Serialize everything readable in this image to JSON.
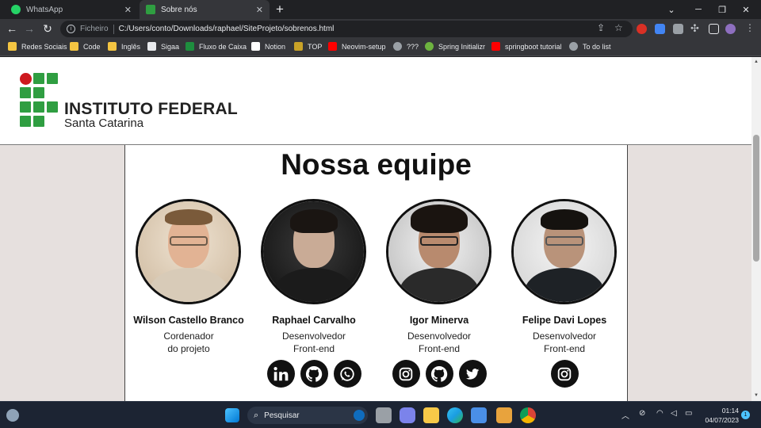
{
  "browser": {
    "tabs": [
      {
        "title": "WhatsApp",
        "close": "✕"
      },
      {
        "title": "Sobre nós",
        "close": "✕"
      }
    ],
    "new_tab": "+",
    "window_controls": {
      "minimize": "─",
      "maximize": "❐",
      "close": "✕",
      "tabsearch": "⌄"
    },
    "address": {
      "scheme": "Ficheiro",
      "url": "C:/Users/conto/Downloads/raphael/SiteProjeto/sobrenos.html"
    },
    "bookmarks": [
      "Redes Sociais",
      "Code",
      "Inglês",
      "Sigaa",
      "Fluxo de Caixa",
      "Notion",
      "TOP",
      "Neovim-setup",
      "???",
      "Spring Initializr",
      "springboot tutorial",
      "To do list"
    ]
  },
  "site": {
    "logo": {
      "line1": "INSTITUTO FEDERAL",
      "line2": "Santa Catarina"
    },
    "heading": "Nossa equipe",
    "members": [
      {
        "name": "Wilson Castello Branco",
        "role_line1": "Cordenador",
        "role_line2": "do projeto",
        "socials": []
      },
      {
        "name": "Raphael Carvalho",
        "role_line1": "Desenvolvedor",
        "role_line2": "Front-end",
        "socials": [
          "linkedin",
          "github",
          "whatsapp"
        ]
      },
      {
        "name": "Igor Minerva",
        "role_line1": "Desenvolvedor",
        "role_line2": "Front-end",
        "socials": [
          "instagram",
          "github",
          "twitter"
        ]
      },
      {
        "name": "Felipe Davi Lopes",
        "role_line1": "Desenvolvedor",
        "role_line2": "Front-end",
        "socials": [
          "instagram"
        ]
      }
    ]
  },
  "taskbar": {
    "search_placeholder": "Pesquisar",
    "time": "01:14",
    "date": "04/07/2023",
    "notifications": "1"
  }
}
